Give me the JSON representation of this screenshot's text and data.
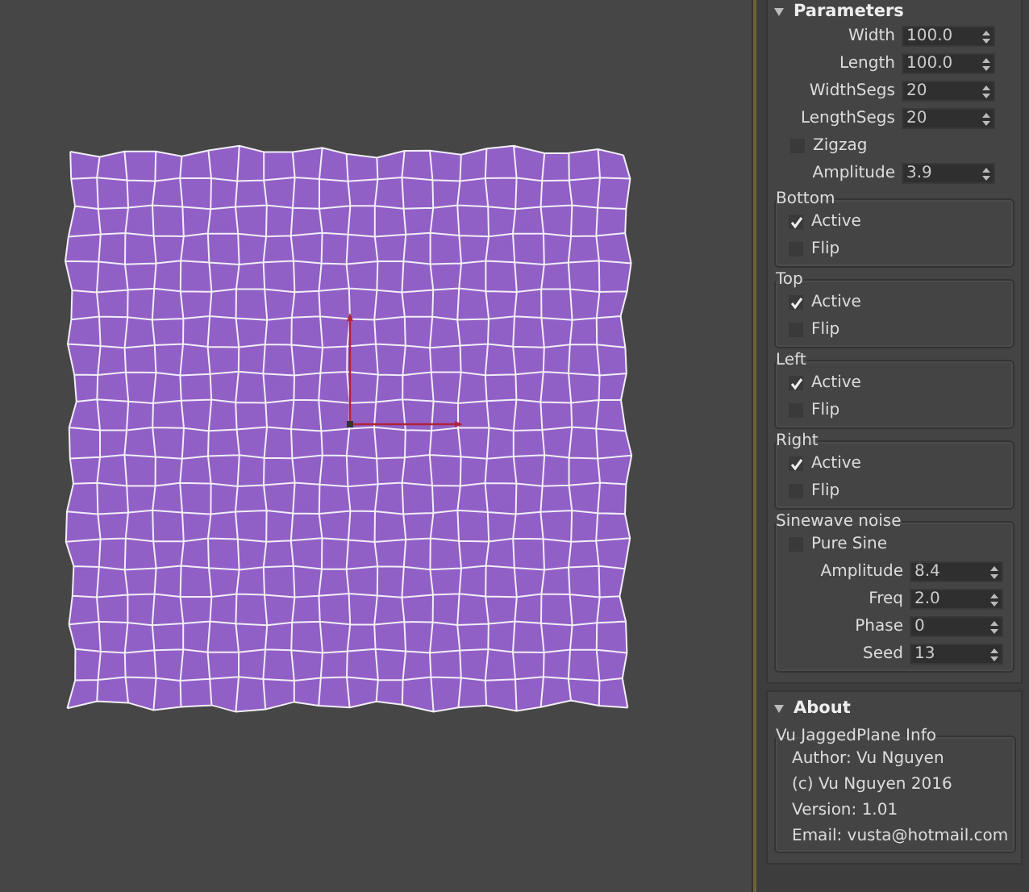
{
  "parameters": {
    "title": "Parameters",
    "expanded": true,
    "spinners": [
      {
        "label": "Width",
        "value": "100.0"
      },
      {
        "label": "Length",
        "value": "100.0"
      },
      {
        "label": "WidthSegs",
        "value": "20"
      },
      {
        "label": "LengthSegs",
        "value": "20"
      }
    ],
    "zigzag": {
      "label": "Zigzag",
      "checked": false
    },
    "amplitude": {
      "label": "Amplitude",
      "value": "3.9"
    },
    "groups": [
      {
        "title": "Bottom",
        "checkboxes": [
          {
            "label": "Active",
            "checked": true
          },
          {
            "label": "Flip",
            "checked": false
          }
        ]
      },
      {
        "title": "Top",
        "checkboxes": [
          {
            "label": "Active",
            "checked": true
          },
          {
            "label": "Flip",
            "checked": false
          }
        ]
      },
      {
        "title": "Left",
        "checkboxes": [
          {
            "label": "Active",
            "checked": true
          },
          {
            "label": "Flip",
            "checked": false
          }
        ]
      },
      {
        "title": "Right",
        "checkboxes": [
          {
            "label": "Active",
            "checked": true
          },
          {
            "label": "Flip",
            "checked": false
          }
        ]
      }
    ],
    "sinewave": {
      "title": "Sinewave noise",
      "pure_sine": {
        "label": "Pure Sine",
        "checked": false
      },
      "spinners": [
        {
          "label": "Amplitude",
          "value": "8.4"
        },
        {
          "label": "Freq",
          "value": "2.0"
        },
        {
          "label": "Phase",
          "value": "0"
        },
        {
          "label": "Seed",
          "value": "13"
        }
      ]
    }
  },
  "about": {
    "title": "About",
    "expanded": true,
    "group_title": "Vu JaggedPlane Info",
    "lines": [
      "Author: Vu Nguyen",
      "(c) Vu Nguyen 2016",
      "Version: 1.01",
      "Email: vusta@hotmail.com"
    ]
  }
}
